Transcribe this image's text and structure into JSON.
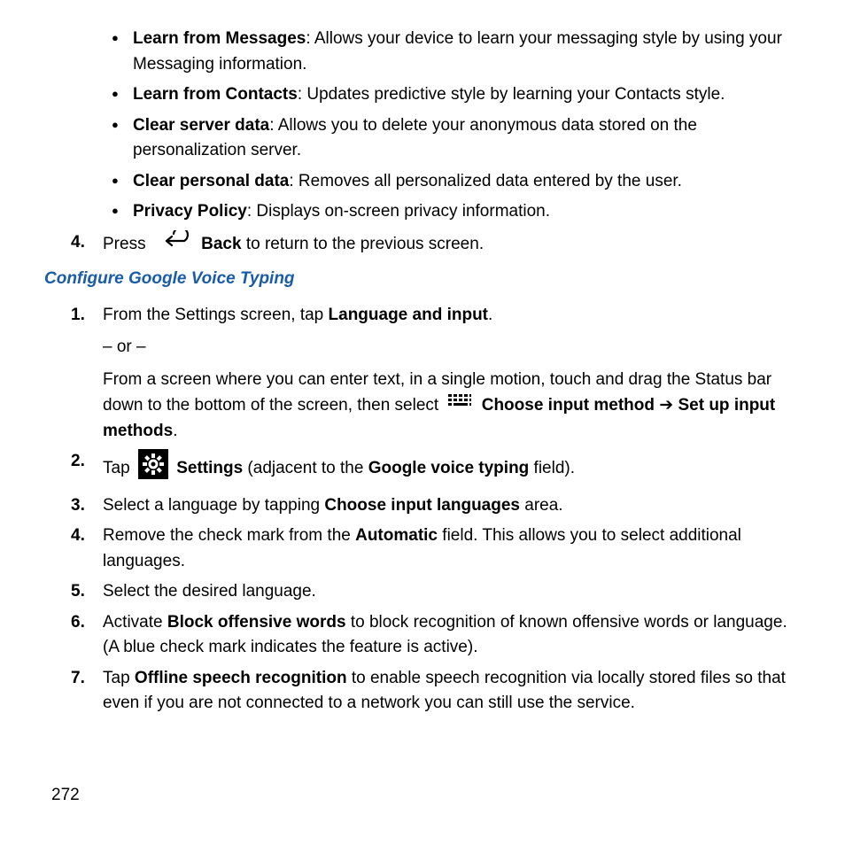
{
  "bullets": [
    {
      "label": "Learn from Messages",
      "desc": ": Allows your device to learn your messaging style by using your Messaging information."
    },
    {
      "label": "Learn from Contacts",
      "desc": ": Updates predictive style by learning your Contacts style."
    },
    {
      "label": "Clear server data",
      "desc": ": Allows you to delete your anonymous data stored on the personalization server."
    },
    {
      "label": "Clear personal data",
      "desc": ": Removes all personalized data entered by the user."
    },
    {
      "label": "Privacy Policy",
      "desc": ": Displays on-screen privacy information."
    }
  ],
  "step4_top": {
    "num": "4.",
    "press": "Press",
    "back": "Back",
    "rest": " to return to the previous screen."
  },
  "heading": "Configure Google Voice Typing",
  "steps": [
    {
      "pre": "From the Settings screen, tap ",
      "b1": "Language and input",
      "post": ".",
      "or": "– or –",
      "line2a": "From a screen where you can enter text, in a single motion, touch and drag the Status bar down to the bottom of the screen, then select ",
      "choose_input_method": "Choose input method",
      "arrow": " ➔ ",
      "setup": "Set up input methods",
      "dot": "."
    },
    {
      "tap": "Tap ",
      "settings": "Settings",
      "adj": " (adjacent to the ",
      "gvt": "Google voice typing",
      "field": " field)."
    },
    {
      "text_pre": "Select a language by tapping ",
      "b1": "Choose input languages",
      "text_post": " area."
    },
    {
      "text_pre": "Remove the check mark from the ",
      "b1": "Automatic",
      "text_post": " field. This allows you to select additional languages."
    },
    {
      "text_pre": "Select the desired language.",
      "b1": "",
      "text_post": ""
    },
    {
      "text_pre": "Activate ",
      "b1": "Block offensive words",
      "text_post": " to block recognition of known offensive words or language. (A blue check mark indicates the feature is active)."
    },
    {
      "text_pre": "Tap ",
      "b1": "Offline speech recognition",
      "text_post": " to enable speech recognition via locally stored files so that even if you are not connected to a network you can still use the service."
    }
  ],
  "page_number": "272"
}
